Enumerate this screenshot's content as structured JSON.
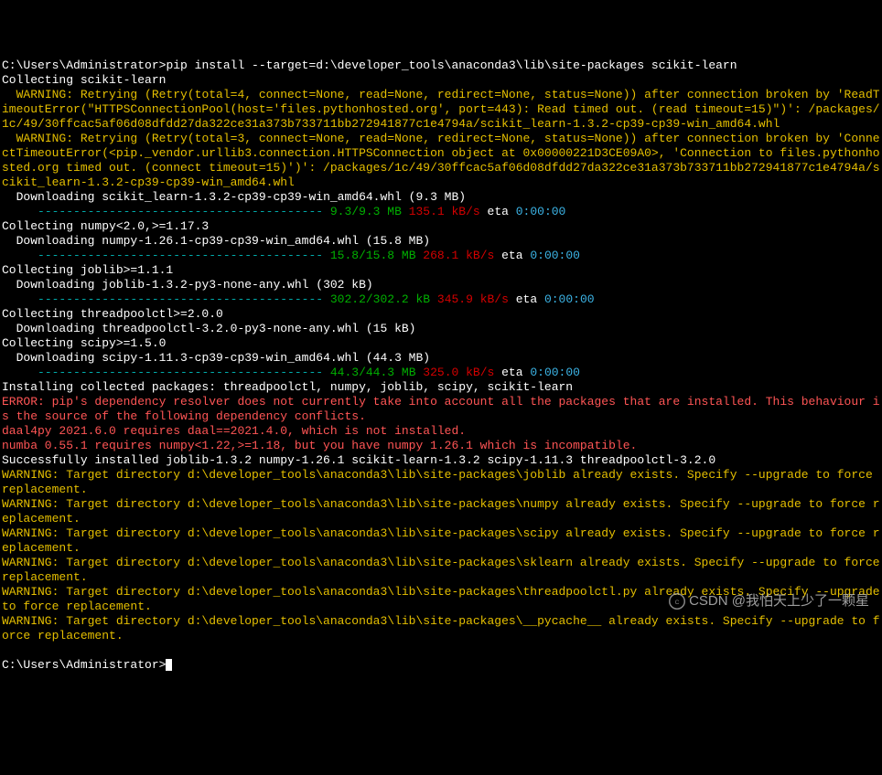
{
  "prompt1": "C:\\Users\\Administrator>",
  "cmd": "pip install --target=d:\\developer_tools\\anaconda3\\lib\\site-packages scikit-learn",
  "collect_sklearn": "Collecting scikit-learn",
  "warn1_a": "  WARNING: Retrying (Retry(total=4, connect=None, read=None, redirect=None, status=None)) after connection broken by 'ReadTimeoutError(\"HTTPSConnectionPool(host='files.pythonhosted.org', port=443): Read timed out. (read timeout=15)\")': /packages/1c/49/30ffcac5af06d08dfdd27da322ce31a373b733711bb272941877c1e4794a/scikit_learn-1.3.2-cp39-cp39-win_amd64.whl",
  "warn2_a": "  WARNING: Retrying (Retry(total=3, connect=None, read=None, redirect=None, status=None)) after connection broken by 'ConnectTimeoutError(<pip._vendor.urllib3.connection.HTTPSConnection object at 0x00000221D3CE09A0>, 'Connection to files.pythonhosted.org timed out. (connect timeout=15)')': /packages/1c/49/30ffcac5af06d08dfdd27da322ce31a373b733711bb272941877c1e4794a/scikit_learn-1.3.2-cp39-cp39-win_amd64.whl",
  "dl_sklearn": "  Downloading scikit_learn-1.3.2-cp39-cp39-win_amd64.whl (9.3 MB)",
  "bar_sklearn_dash": "     ---------------------------------------- ",
  "bar_sklearn_size": "9.3/9.3 MB",
  "bar_sklearn_speed": " 135.1 kB/s",
  "bar_sklearn_eta": " eta ",
  "bar_sklearn_time": "0:00:00",
  "collect_numpy": "Collecting numpy<2.0,>=1.17.3",
  "dl_numpy": "  Downloading numpy-1.26.1-cp39-cp39-win_amd64.whl (15.8 MB)",
  "bar_numpy_dash": "     ---------------------------------------- ",
  "bar_numpy_size": "15.8/15.8 MB",
  "bar_numpy_speed": " 268.1 kB/s",
  "bar_numpy_eta": " eta ",
  "bar_numpy_time": "0:00:00",
  "collect_joblib": "Collecting joblib>=1.1.1",
  "dl_joblib": "  Downloading joblib-1.3.2-py3-none-any.whl (302 kB)",
  "bar_joblib_dash": "     ---------------------------------------- ",
  "bar_joblib_size": "302.2/302.2 kB",
  "bar_joblib_speed": " 345.9 kB/s",
  "bar_joblib_eta": " eta ",
  "bar_joblib_time": "0:00:00",
  "collect_tpc": "Collecting threadpoolctl>=2.0.0",
  "dl_tpc": "  Downloading threadpoolctl-3.2.0-py3-none-any.whl (15 kB)",
  "collect_scipy": "Collecting scipy>=1.5.0",
  "dl_scipy": "  Downloading scipy-1.11.3-cp39-cp39-win_amd64.whl (44.3 MB)",
  "bar_scipy_dash": "     ---------------------------------------- ",
  "bar_scipy_size": "44.3/44.3 MB",
  "bar_scipy_speed": " 325.0 kB/s",
  "bar_scipy_eta": " eta ",
  "bar_scipy_time": "0:00:00",
  "install_pkgs": "Installing collected packages: threadpoolctl, numpy, joblib, scipy, scikit-learn",
  "err_dep": "ERROR: pip's dependency resolver does not currently take into account all the packages that are installed. This behaviour is the source of the following dependency conflicts.",
  "err_daal": "daal4py 2021.6.0 requires daal==2021.4.0, which is not installed.",
  "err_numba": "numba 0.55.1 requires numpy<1.22,>=1.18, but you have numpy 1.26.1 which is incompatible.",
  "success": "Successfully installed joblib-1.3.2 numpy-1.26.1 scikit-learn-1.3.2 scipy-1.11.3 threadpoolctl-3.2.0",
  "warn_joblib": "WARNING: Target directory d:\\developer_tools\\anaconda3\\lib\\site-packages\\joblib already exists. Specify --upgrade to force replacement.",
  "warn_numpy": "WARNING: Target directory d:\\developer_tools\\anaconda3\\lib\\site-packages\\numpy already exists. Specify --upgrade to force replacement.",
  "warn_scipy": "WARNING: Target directory d:\\developer_tools\\anaconda3\\lib\\site-packages\\scipy already exists. Specify --upgrade to force replacement.",
  "warn_sklearn": "WARNING: Target directory d:\\developer_tools\\anaconda3\\lib\\site-packages\\sklearn already exists. Specify --upgrade to force replacement.",
  "warn_tpc": "WARNING: Target directory d:\\developer_tools\\anaconda3\\lib\\site-packages\\threadpoolctl.py already exists. Specify --upgrade to force replacement.",
  "warn_pycache": "WARNING: Target directory d:\\developer_tools\\anaconda3\\lib\\site-packages\\__pycache__ already exists. Specify --upgrade to force replacement.",
  "blank": "",
  "prompt2": "C:\\Users\\Administrator>",
  "watermark": "CSDN @我怕天上少了一颗星"
}
